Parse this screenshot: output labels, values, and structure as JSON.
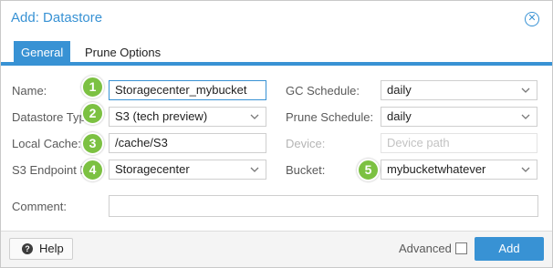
{
  "dialog": {
    "title": "Add: Datastore",
    "close_icon": "close-circle-icon"
  },
  "tabs": [
    {
      "label": "General",
      "active": true
    },
    {
      "label": "Prune Options",
      "active": false
    }
  ],
  "form": {
    "name": {
      "label": "Name:",
      "value": "Storagecenter_mybucket"
    },
    "datastore_type": {
      "label": "Datastore Type:",
      "value": "S3 (tech preview)"
    },
    "local_cache": {
      "label": "Local Cache:",
      "value": "/cache/S3"
    },
    "s3_endpoint": {
      "label": "S3 Endpoint ID:",
      "value": "Storagecenter"
    },
    "gc_schedule": {
      "label": "GC Schedule:",
      "value": "daily"
    },
    "prune_schedule": {
      "label": "Prune Schedule:",
      "value": "daily"
    },
    "device": {
      "label": "Device:",
      "placeholder": "Device path"
    },
    "bucket": {
      "label": "Bucket:",
      "value": "mybucketwhatever"
    },
    "comment": {
      "label": "Comment:",
      "value": ""
    }
  },
  "callouts": [
    "1",
    "2",
    "3",
    "4",
    "5"
  ],
  "footer": {
    "help_label": "Help",
    "help_icon": "question-circle-icon",
    "advanced_label": "Advanced",
    "advanced_checked": false,
    "add_label": "Add"
  },
  "colors": {
    "accent": "#3892d4",
    "callout": "#7cc142"
  }
}
